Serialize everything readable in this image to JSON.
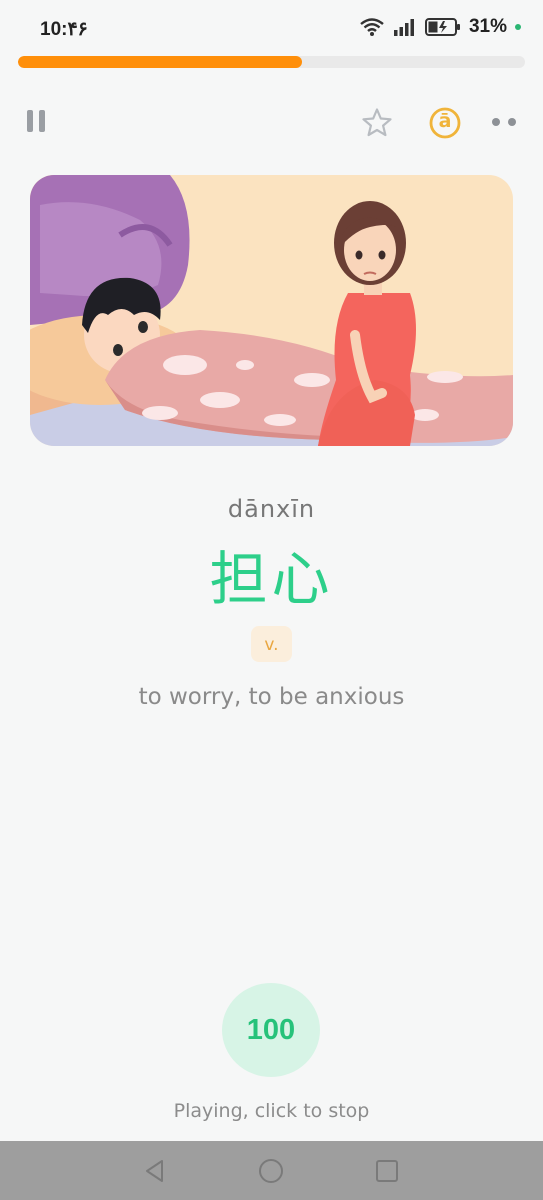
{
  "status_bar": {
    "time": "10:۴۶",
    "battery_percent": "31%",
    "icons": [
      "wifi-icon",
      "signal-icon",
      "battery-charging-icon"
    ]
  },
  "lesson_progress": 0.56,
  "toolbar": {
    "pause_icon": "pause-icon",
    "favorite_icon": "star-icon",
    "pinyin_toggle_icon": "pinyin-toggle-icon",
    "more_icon": "more-dots-icon",
    "pinyin_toggle_glyph": "ā"
  },
  "word": {
    "pinyin": "dānxīn",
    "hanzi": "担心",
    "part_of_speech": "v.",
    "meaning": "to worry, to be anxious"
  },
  "score": {
    "value": "100",
    "status_text": "Playing, click to stop"
  },
  "colors": {
    "progress": "#ff8f0a",
    "hanzi": "#2dcf8a",
    "accent_yellow": "#f0b43a",
    "score_bg": "#d7f4e6",
    "score_text": "#26c27a"
  }
}
